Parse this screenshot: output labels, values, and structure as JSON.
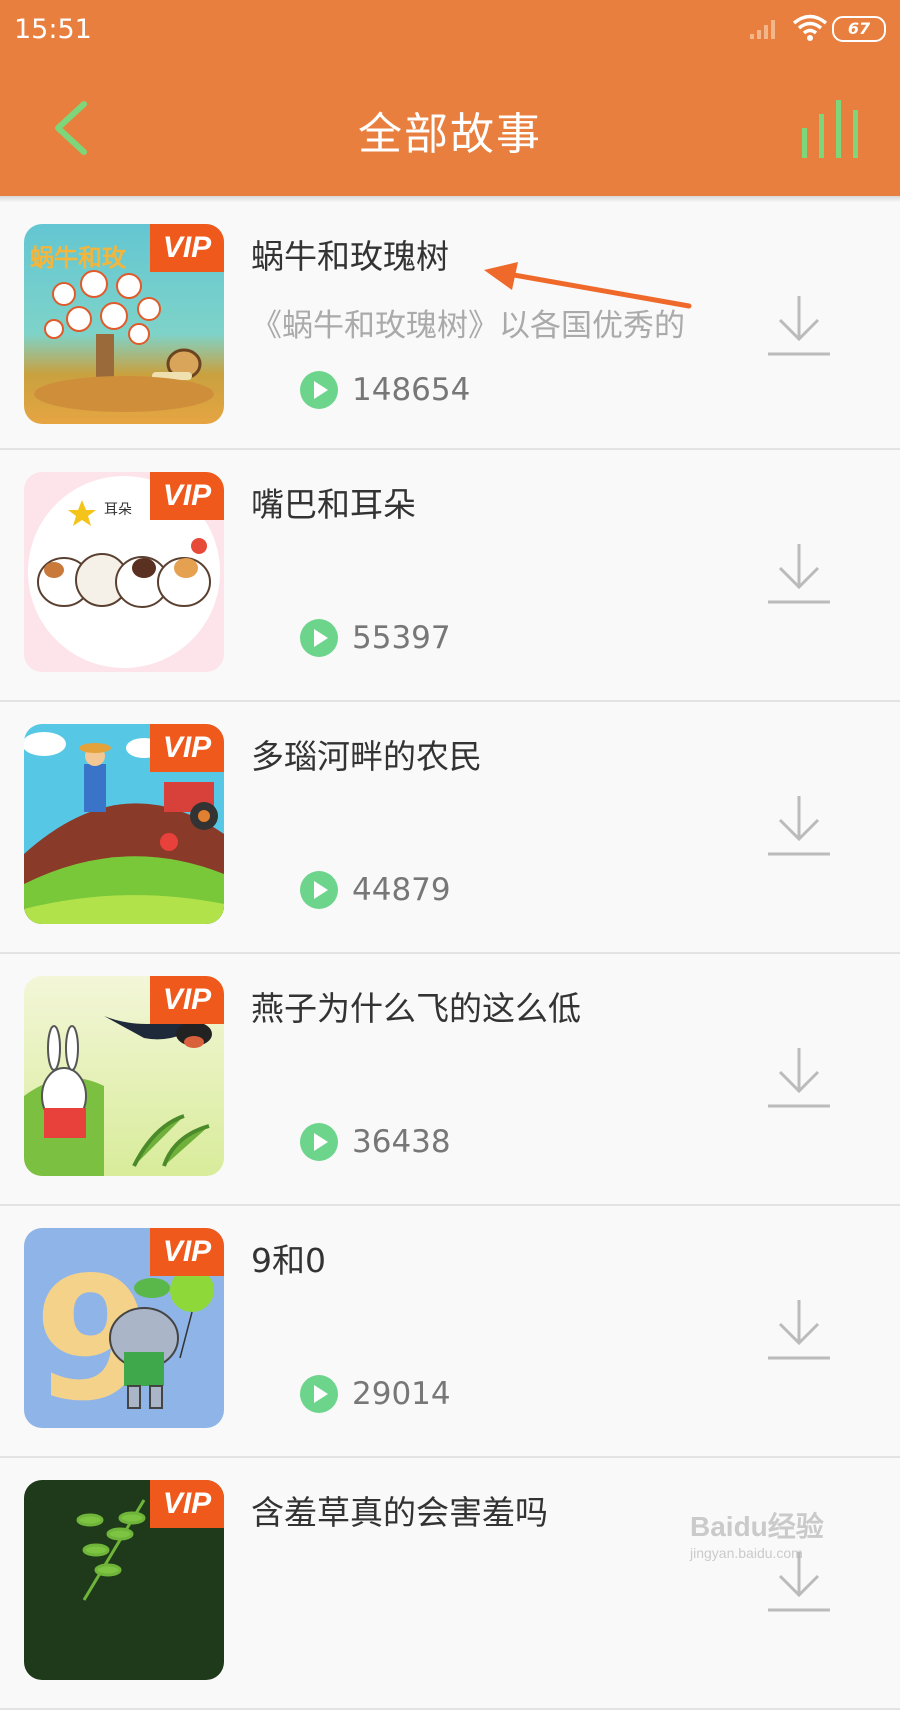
{
  "status_bar": {
    "time": "15:51",
    "battery": "67"
  },
  "header": {
    "title": "全部故事"
  },
  "stories": [
    {
      "title": "蜗牛和玫瑰树",
      "description": "《蜗牛和玫瑰树》以各国优秀的",
      "plays": "148654",
      "badge": "VIP",
      "thumb_text": "蜗牛和玫"
    },
    {
      "title": "嘴巴和耳朵",
      "description": "",
      "plays": "55397",
      "badge": "VIP",
      "thumb_text": "耳朵"
    },
    {
      "title": "多瑙河畔的农民",
      "description": "",
      "plays": "44879",
      "badge": "VIP"
    },
    {
      "title": "燕子为什么飞的这么低",
      "description": "",
      "plays": "36438",
      "badge": "VIP"
    },
    {
      "title": "9和0",
      "description": "",
      "plays": "29014",
      "badge": "VIP",
      "thumb_text": "9"
    },
    {
      "title": "含羞草真的会害羞吗",
      "description": "",
      "plays": "",
      "badge": "VIP"
    }
  ],
  "watermark": {
    "brand": "Baidu经验",
    "url": "jingyan.baidu.com"
  },
  "colors": {
    "header": "#e97f3e",
    "vip": "#ef5a1c",
    "play": "#6dd48c",
    "accent_green": "#7ed67a"
  }
}
